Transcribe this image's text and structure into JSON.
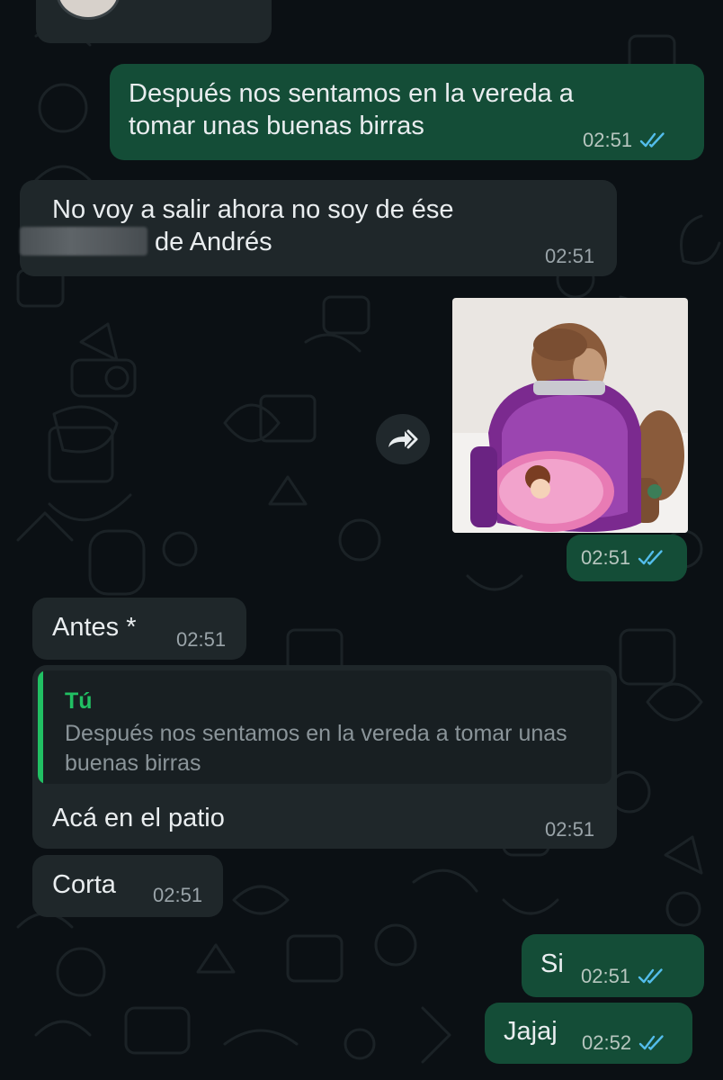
{
  "messages": [
    {
      "dir": "out",
      "text": "Después nos sentamos en la vereda a tomar unas buenas birras",
      "time": "02:51",
      "status": "read"
    },
    {
      "dir": "in",
      "text_before_redaction": "No voy a salir ahora no soy de ése",
      "text_after_redaction": "de Andrés",
      "time": "02:51"
    },
    {
      "dir": "out",
      "type": "image",
      "image_description": "monkey-with-purple-backpack",
      "time": "02:51",
      "status": "read"
    },
    {
      "dir": "in",
      "text": "Antes *",
      "time": "02:51"
    },
    {
      "dir": "in",
      "reply_to": {
        "author": "Tú",
        "text": "Después nos sentamos en la vereda a tomar unas buenas birras"
      },
      "text": "Acá en el patio",
      "time": "02:51"
    },
    {
      "dir": "in",
      "text": "Corta",
      "time": "02:51"
    },
    {
      "dir": "out",
      "text": "Si",
      "time": "02:51",
      "status": "read"
    },
    {
      "dir": "out",
      "text": "Jajaj",
      "time": "02:52",
      "status": "read"
    }
  ],
  "icons": {
    "read_receipt": "double-check-icon",
    "forward": "forward-icon"
  },
  "colors": {
    "background": "#0b1014",
    "outgoing_bubble": "#144d37",
    "incoming_bubble": "#1f272a",
    "read_tick": "#53bdeb",
    "quote_accent": "#21c063"
  }
}
